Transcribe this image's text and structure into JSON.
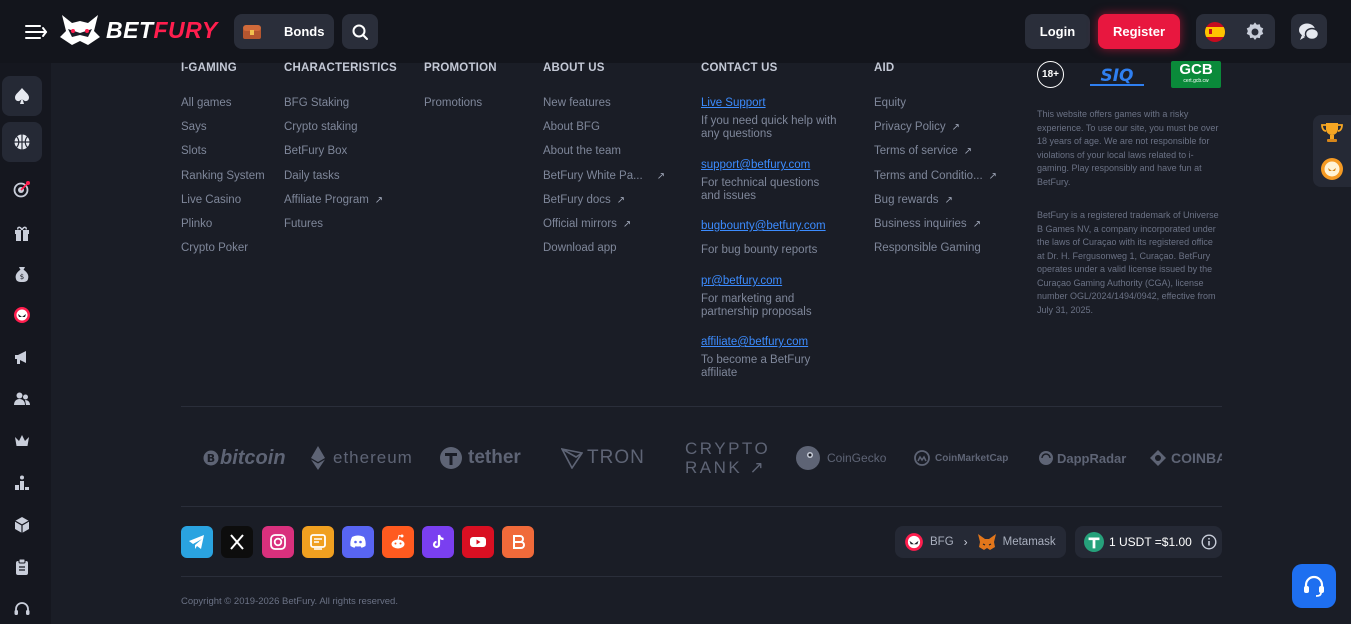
{
  "header": {
    "logo": {
      "part1": "BET",
      "part2": "FURY"
    },
    "bonds_label": "Bonds",
    "login_label": "Login",
    "register_label": "Register",
    "accent_color": "#e8173f",
    "link_color": "#3c8cff"
  },
  "sidebar": {
    "items": [
      "spade-icon",
      "basketball-icon",
      "target-icon",
      "gift-icon",
      "money-bag-icon",
      "bfg-token-icon",
      "megaphone-icon",
      "users-icon",
      "crown-icon",
      "leaderboard-icon",
      "cube-icon",
      "clipboard-icon",
      "headset-icon"
    ]
  },
  "columns": {
    "igaming": {
      "title": "I-GAMING",
      "links": [
        "All games",
        "Says",
        "Slots",
        "Ranking System",
        "Live Casino",
        "Plinko",
        "Crypto Poker"
      ]
    },
    "characteristics": {
      "title": "CHARACTERISTICS",
      "links": [
        "BFG Staking",
        "Crypto staking",
        "BetFury Box",
        "Daily tasks",
        "Affiliate Program",
        "Futures"
      ]
    },
    "promotion": {
      "title": "PROMOTION",
      "links": [
        "Promotions"
      ]
    },
    "about": {
      "title": "ABOUT US",
      "links": [
        "New features",
        "About BFG",
        "About the team",
        "BetFury White Pa...",
        "BetFury docs",
        "Official mirrors",
        "Download app"
      ]
    },
    "contact": {
      "title": "CONTACT US",
      "entries": [
        {
          "link": "Live Support",
          "desc": "If you need quick help with any questions"
        },
        {
          "link": "support@betfury.com",
          "desc": "For technical questions and issues"
        },
        {
          "link": "bugbounty@betfury.com",
          "desc": "For bug bounty reports"
        },
        {
          "link": "pr@betfury.com",
          "desc": "For marketing and partnership proposals"
        },
        {
          "link": "affiliate@betfury.com",
          "desc": "To become a BetFury affiliate"
        }
      ]
    },
    "aid": {
      "title": "AID",
      "links": [
        "Equity",
        "Privacy Policy",
        "Terms of service",
        "Terms and Conditio...",
        "Bug rewards",
        "Business inquiries",
        "Responsible Gaming"
      ]
    }
  },
  "licenses": {
    "age": "18+",
    "sig": "SIQ",
    "gcb_title": "GCB",
    "gcb_sub": "cert.gcb.cw",
    "disclaimer1": "This website offers games with a risky experience. To use our site, you must be over 18 years of age. We are not responsible for violations of your local laws related to i-gaming. Play responsibly and have fun at BetFury.",
    "disclaimer2": "BetFury is a registered trademark of Universe B Games NV, a company incorporated under the laws of Curaçao with its registered office at Dr. H. Fergusonweg 1, Curaçao. BetFury operates under a valid license issued by the Curaçao Gaming Authority (CGA), license number OGL/2024/1494/0942, effective from July 31, 2025."
  },
  "partners": {
    "bitcoin": "bitcoin",
    "ethereum": "ethereum",
    "tether": "tether",
    "tron": "TRON",
    "crypto_rank_1": "CRYPTO",
    "crypto_rank_2": "RANK",
    "coingecko": "CoinGecko",
    "coinmarketcap": "CoinMarketCap",
    "dappradar": "DappRadar",
    "coinbase": "COINBASE"
  },
  "socials": [
    "telegram-icon",
    "x-icon",
    "instagram-icon",
    "blog-icon",
    "discord-icon",
    "reddit-icon",
    "tiktok-icon",
    "youtube-icon",
    "bitcointalk-icon"
  ],
  "wallet": {
    "from": "BFG",
    "to": "Metamask",
    "rate": "1 USDT =$1.00"
  },
  "copyright": "Copyright © 2019-2026 BetFury. All rights reserved."
}
